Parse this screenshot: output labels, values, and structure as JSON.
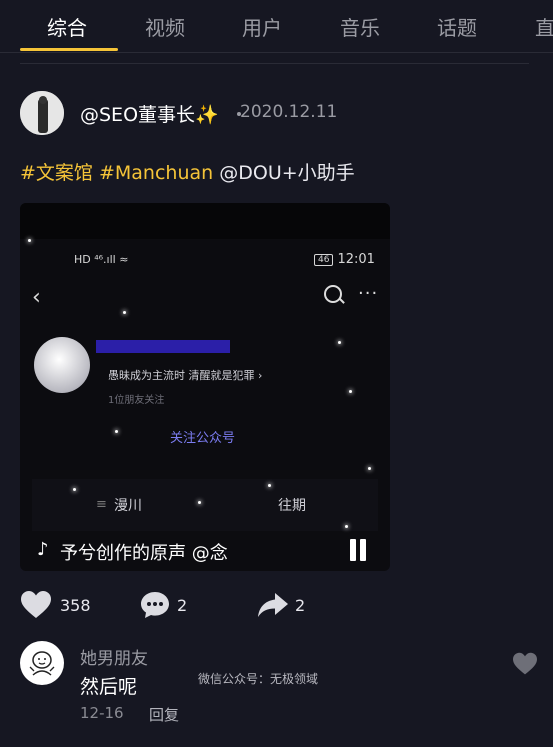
{
  "tabs": [
    {
      "label": "综合",
      "active": true
    },
    {
      "label": "视频"
    },
    {
      "label": "用户"
    },
    {
      "label": "音乐"
    },
    {
      "label": "话题"
    },
    {
      "label": "直"
    }
  ],
  "post": {
    "username": "@SEO董事长✨",
    "date": "2020.12.11",
    "caption": {
      "hashtag1": "#文案馆",
      "hashtag2": "#Manchuan",
      "mention": "@DOU+小助手"
    }
  },
  "video": {
    "status_left": "HD ⁴⁶.ıll ≈",
    "battery": "46",
    "time": "12:01",
    "signature": "愚昧成为主流时 清醒就是犯罪 ›",
    "friends": "1位朋友关注",
    "follow_label": "关注公众号",
    "menu_left": "漫川",
    "menu_right": "往期",
    "music_text": "予兮创作的原声    @念"
  },
  "actions": {
    "likes": "358",
    "comments": "2",
    "shares": "2"
  },
  "comment": {
    "name": "她男朋友",
    "text": "然后呢",
    "date": "12-16",
    "reply_label": "回复",
    "watermark": "微信公众号：无极领域"
  },
  "colors": {
    "background": "#161722",
    "accent": "#f5c438",
    "follow": "#7b7cf0"
  }
}
